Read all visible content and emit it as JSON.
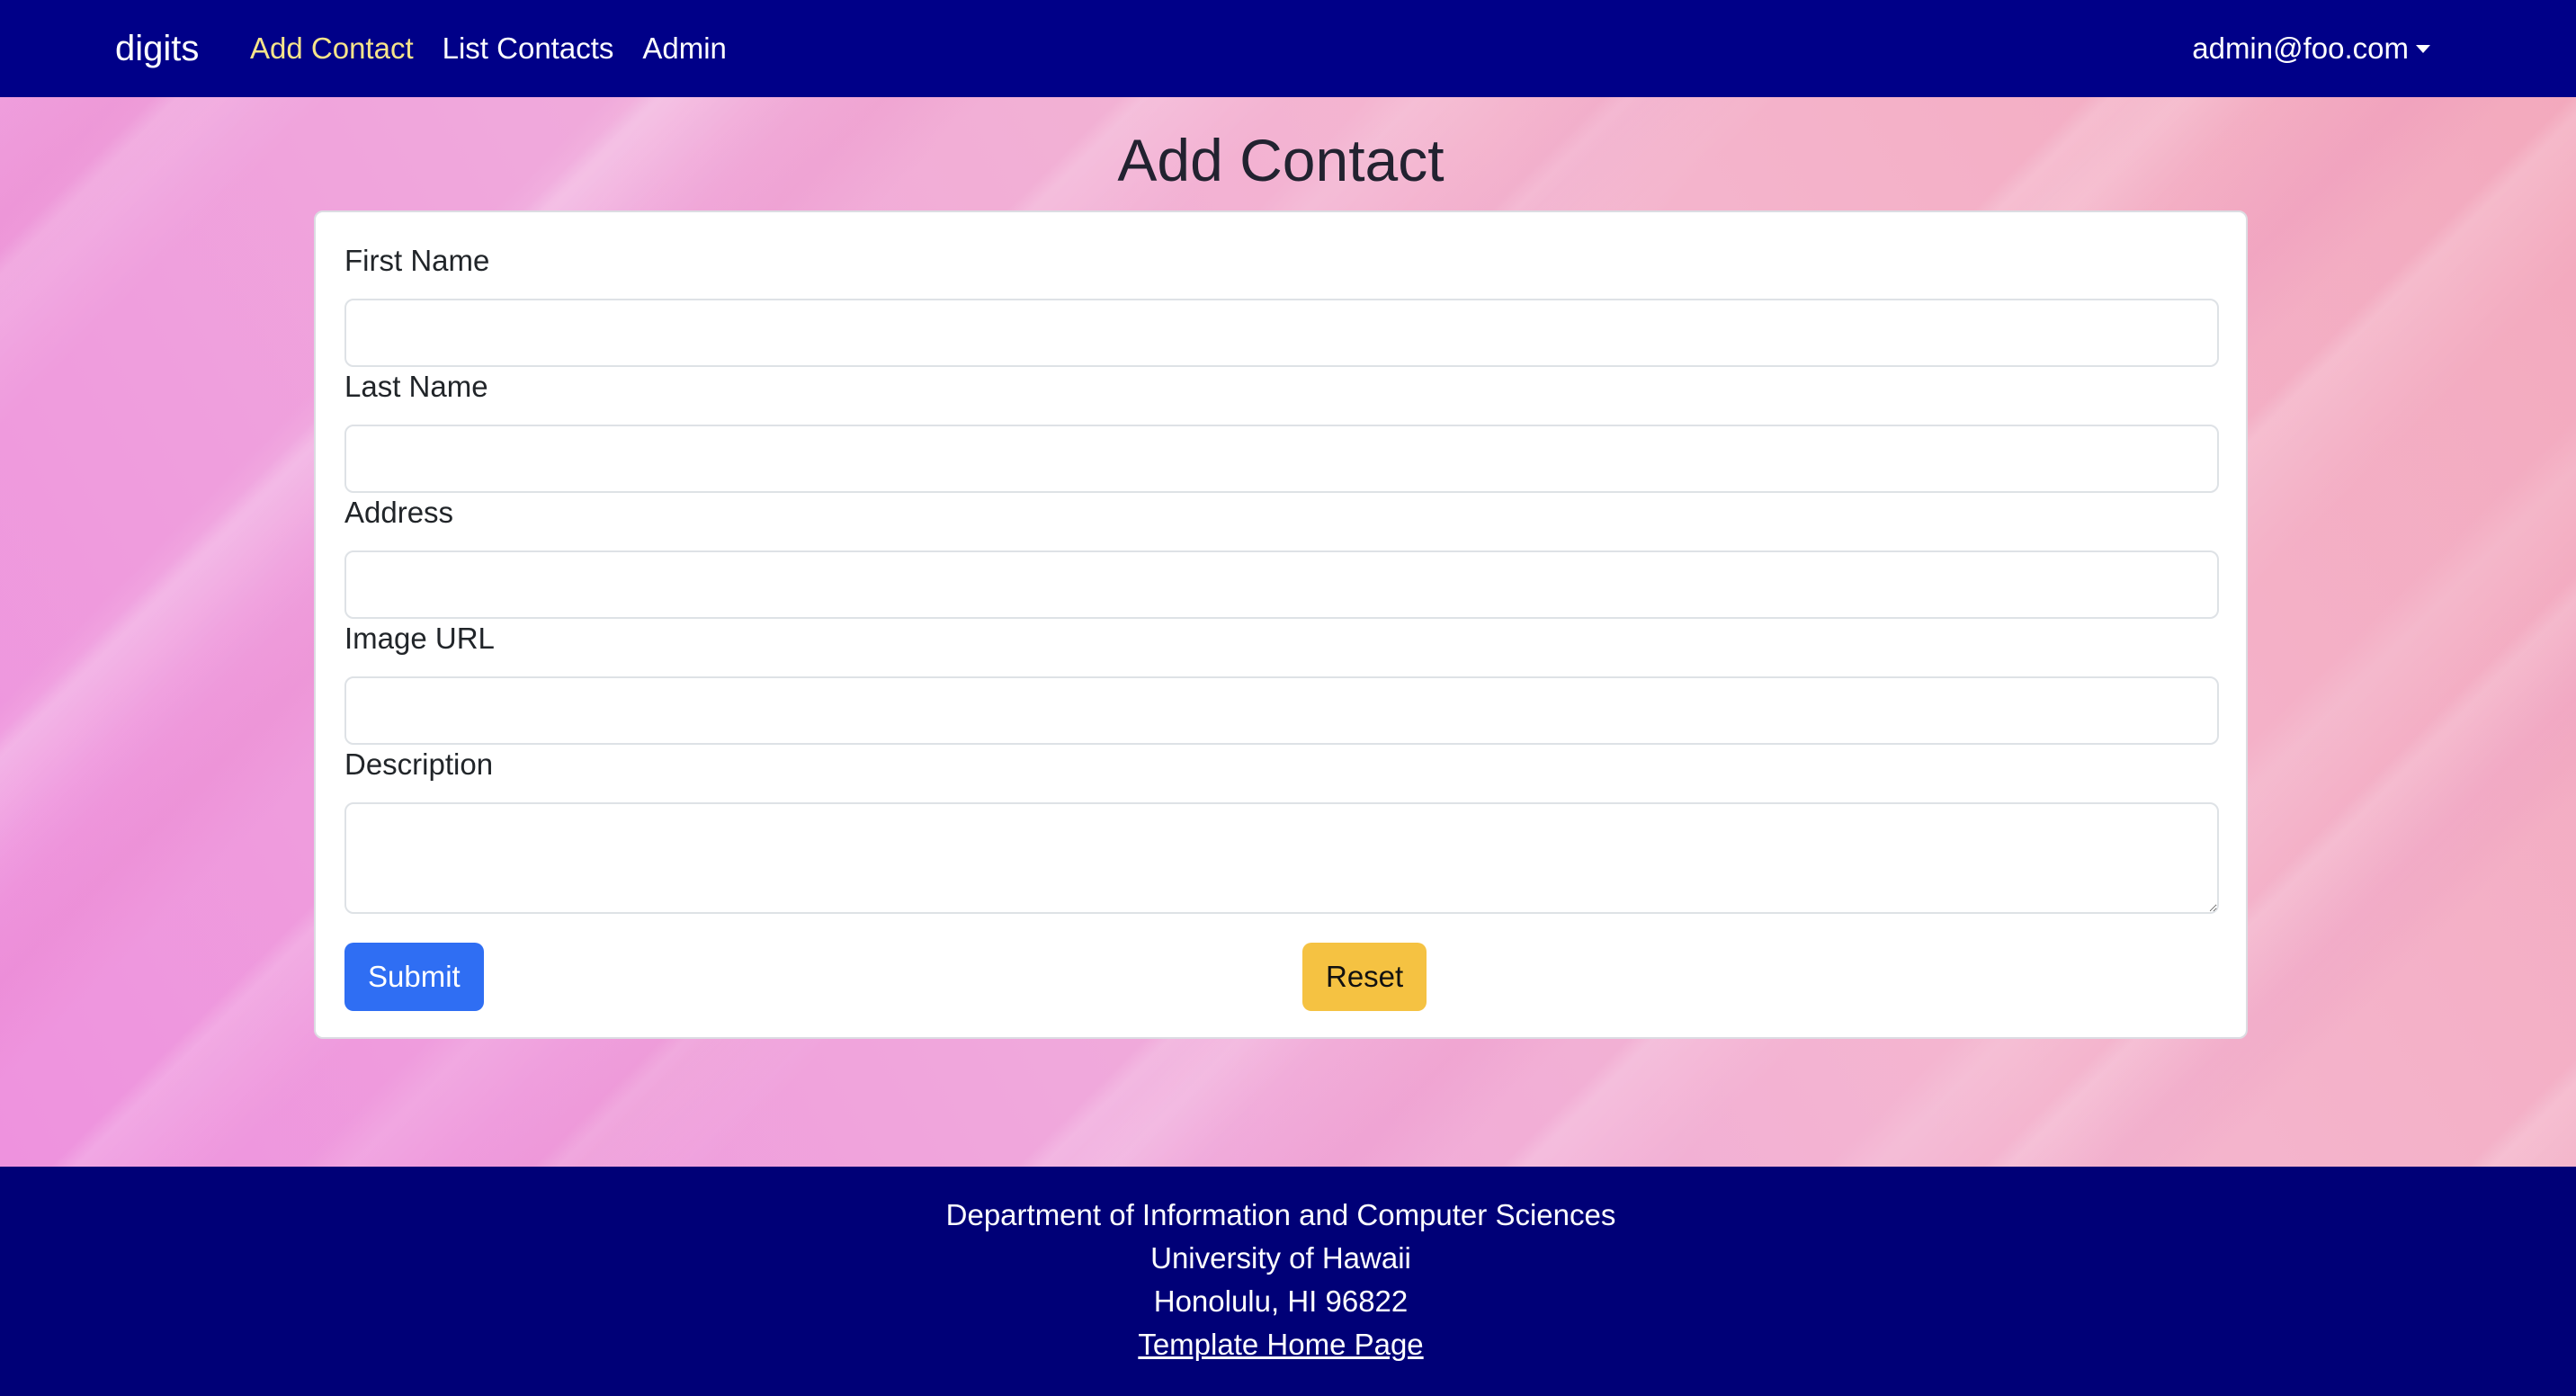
{
  "navbar": {
    "brand": "digits",
    "links": [
      {
        "label": "Add Contact",
        "active": true
      },
      {
        "label": "List Contacts",
        "active": false
      },
      {
        "label": "Admin",
        "active": false
      }
    ],
    "user": "admin@foo.com",
    "background_color": "#000088",
    "active_link_color": "#f7e48a"
  },
  "page": {
    "title": "Add Contact"
  },
  "form": {
    "fields": [
      {
        "label": "First Name",
        "value": ""
      },
      {
        "label": "Last Name",
        "value": ""
      },
      {
        "label": "Address",
        "value": ""
      },
      {
        "label": "Image URL",
        "value": ""
      },
      {
        "label": "Description",
        "value": ""
      }
    ],
    "submit_label": "Submit",
    "reset_label": "Reset",
    "submit_color": "#2f6ef3",
    "reset_color": "#f5c242"
  },
  "footer": {
    "line1": "Department of Information and Computer Sciences",
    "line2": "University of Hawaii",
    "line3": "Honolulu, HI 96822",
    "link": "Template Home Page",
    "background_color": "#000077"
  }
}
